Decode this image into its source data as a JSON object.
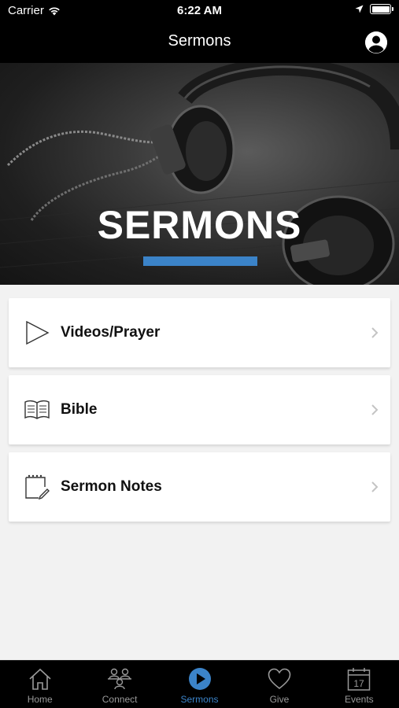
{
  "status_bar": {
    "carrier": "Carrier",
    "time": "6:22 AM"
  },
  "nav": {
    "title": "Sermons",
    "profile_icon": "person-circle-icon"
  },
  "hero": {
    "title": "SERMONS",
    "accent_color": "#3b83c8"
  },
  "menu": {
    "items": [
      {
        "label": "Videos/Prayer",
        "icon": "play-outline-icon"
      },
      {
        "label": "Bible",
        "icon": "open-book-icon"
      },
      {
        "label": "Sermon Notes",
        "icon": "notepad-pencil-icon"
      }
    ]
  },
  "tabs": [
    {
      "label": "Home",
      "icon": "home-icon",
      "active": false
    },
    {
      "label": "Connect",
      "icon": "people-icon",
      "active": false
    },
    {
      "label": "Sermons",
      "icon": "play-circle-icon",
      "active": true
    },
    {
      "label": "Give",
      "icon": "heart-icon",
      "active": false
    },
    {
      "label": "Events",
      "icon": "calendar-icon",
      "active": false,
      "badge": "17"
    }
  ],
  "colors": {
    "active_tab": "#3b83c8",
    "inactive_tab": "#9a9a9a",
    "bar_background": "#000000"
  }
}
